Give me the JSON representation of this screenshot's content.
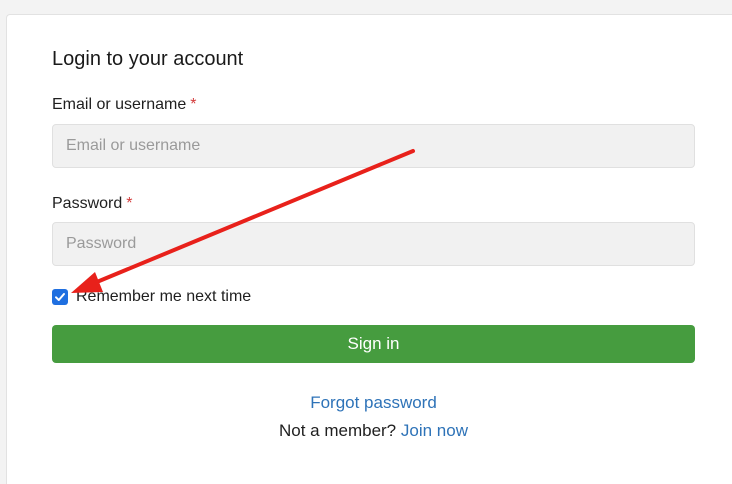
{
  "login": {
    "title": "Login to your account",
    "email": {
      "label": "Email or username",
      "required_mark": "*",
      "placeholder": "Email or username",
      "value": ""
    },
    "password": {
      "label": "Password",
      "required_mark": "*",
      "placeholder": "Password",
      "value": ""
    },
    "remember": {
      "label": "Remember me next time",
      "checked": true
    },
    "signin_label": "Sign in",
    "forgot_label": "Forgot password",
    "not_member_text": "Not a member?",
    "join_label": "Join now"
  },
  "colors": {
    "primary_button": "#469c3f",
    "link": "#2e73b8",
    "required": "#d33a3a",
    "checkbox": "#1f6fe0",
    "annotation_arrow": "#e8211b"
  },
  "icons": {
    "checkbox": "checkmark-icon",
    "annotation": "red-arrow-annotation"
  }
}
